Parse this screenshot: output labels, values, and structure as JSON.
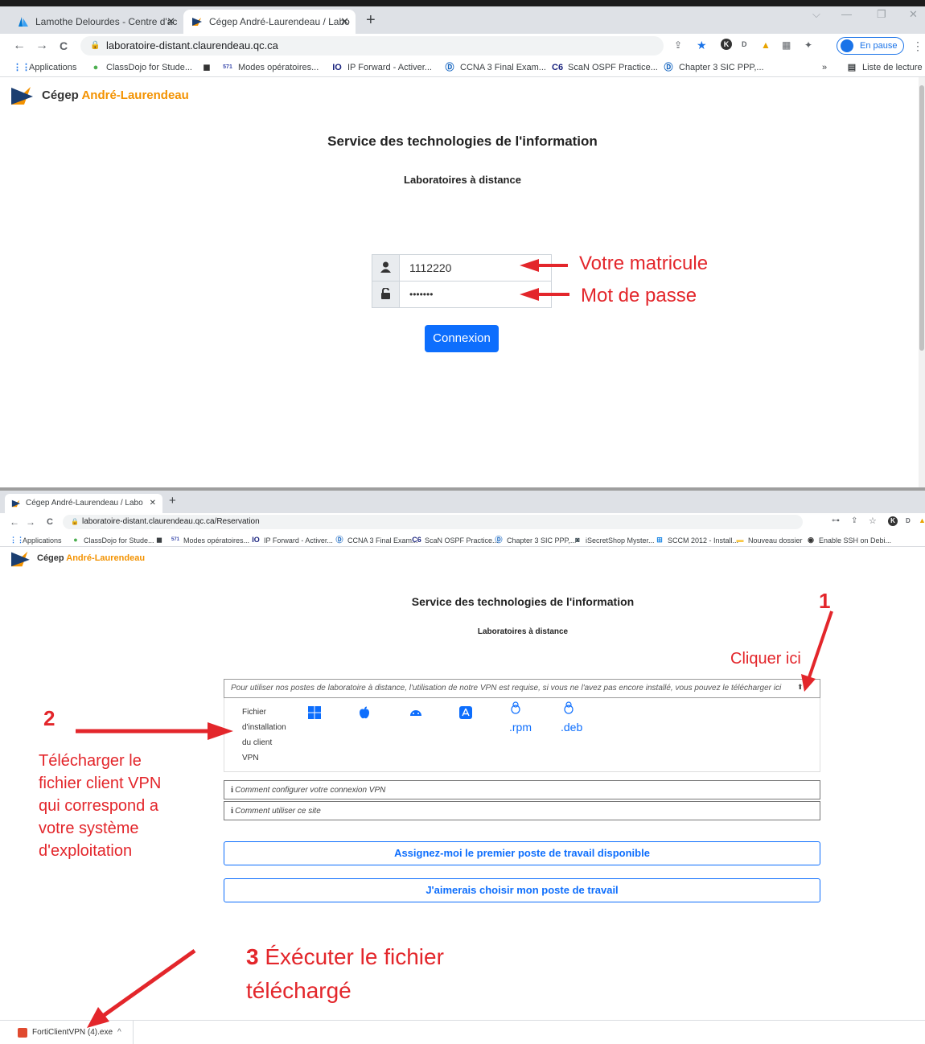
{
  "top": {
    "tabs": [
      {
        "title": "Lamothe Delourdes - Centre d'ac",
        "close": "✕"
      },
      {
        "title": "Cégep André-Laurendeau / Labo",
        "close": "✕"
      }
    ],
    "new_tab": "+",
    "window_controls": {
      "dropdown": "⌵",
      "minimize": "—",
      "restore": "❐",
      "close": "✕"
    },
    "nav": {
      "back": "←",
      "forward": "→",
      "reload": "C"
    },
    "url": "laboratoire-distant.claurendeau.qc.ca",
    "toolbar_icons": {
      "share": "⇪",
      "star": "★",
      "ext_k": "K",
      "ext_d": "D",
      "ext_3": "▲",
      "ext_4": "▦",
      "puzzle": "✦",
      "menu": "⋮"
    },
    "profile_label": "En pause",
    "bookmarks": [
      {
        "icon": "⋮⋮",
        "label": "Applications"
      },
      {
        "icon": "●",
        "label": "ClassDojo for Stude..."
      },
      {
        "icon": "◼",
        "label": ""
      },
      {
        "icon": "571",
        "label": "Modes opératoires..."
      },
      {
        "icon": "IO",
        "label": "IP Forward - Activer..."
      },
      {
        "icon": "Ⓓ",
        "label": "CCNA 3 Final Exam..."
      },
      {
        "icon": "C6",
        "label": "ScaN OSPF Practice..."
      },
      {
        "icon": "Ⓓ",
        "label": "Chapter 3 SIC PPP,..."
      }
    ],
    "bookmarks_more": "»",
    "reading_list": "Liste de lecture",
    "logo": {
      "prefix": "Cégep ",
      "accent": "André-Laurendeau"
    },
    "heading": "Service des technologies de l'information",
    "subheading": "Laboratoires à distance",
    "username_value": "1112220",
    "password_value": "•••••••",
    "login_button": "Connexion"
  },
  "bottom": {
    "tab_title": "Cégep André-Laurendeau / Labo",
    "tab_close": "✕",
    "new_tab": "+",
    "nav": {
      "back": "←",
      "forward": "→",
      "reload": "C"
    },
    "url": "laboratoire-distant.claurendeau.qc.ca/Reservation",
    "toolbar_icons": {
      "key": "⊶",
      "share": "⇪",
      "star": "☆",
      "ext_k": "K",
      "ext_d": "D",
      "ext_3": "▲"
    },
    "bookmarks": [
      {
        "icon": "⋮⋮",
        "label": "Applications"
      },
      {
        "icon": "●",
        "label": "ClassDojo for Stude..."
      },
      {
        "icon": "◼",
        "label": ""
      },
      {
        "icon": "571",
        "label": "Modes opératoires..."
      },
      {
        "icon": "IO",
        "label": "IP Forward - Activer..."
      },
      {
        "icon": "Ⓓ",
        "label": "CCNA 3 Final Exam..."
      },
      {
        "icon": "C6",
        "label": "ScaN OSPF Practice..."
      },
      {
        "icon": "Ⓓ",
        "label": "Chapter 3 SIC PPP,..."
      },
      {
        "icon": "◙",
        "label": "iSecretShop Myster..."
      },
      {
        "icon": "⊞",
        "label": "SCCM 2012 - Install..."
      },
      {
        "icon": "▬",
        "label": "Nouveau dossier"
      },
      {
        "icon": "◉",
        "label": "Enable SSH on Debi..."
      }
    ],
    "logo": {
      "prefix": "Cégep ",
      "accent": "André-Laurendeau"
    },
    "heading": "Service des technologies de l'information",
    "subheading": "Laboratoires à distance",
    "vpn_notice": "Pour utiliser nos postes de laboratoire à distance, l'utilisation de notre VPN est requise, si vous ne l'avez pas encore installé, vous pouvez le télécharger ici",
    "vpn_download_icon": "⬆",
    "installer_label_lines": [
      "Fichier",
      "d'installation",
      "du client",
      "VPN"
    ],
    "os_labels": {
      "rpm": ".rpm",
      "deb": ".deb"
    },
    "info_icon": "i",
    "info_rows": [
      "Comment configurer votre connexion VPN",
      "Comment utiliser ce site"
    ],
    "assign_button": "Assignez-moi le premier poste de travail disponible",
    "choose_button": "J'aimerais choisir mon poste de travail",
    "download_file": "FortiClientVPN (4).exe",
    "download_chevron": "^"
  },
  "annotations": {
    "matricule": "Votre matricule",
    "password": "Mot de passe",
    "step1_number": "1",
    "step1_text": "Cliquer ici",
    "step2_number": "2",
    "step2_lines": [
      "Télécharger le",
      "fichier client VPN",
      "qui correspond a",
      "votre système",
      "d'exploitation"
    ],
    "step3_number": "3",
    "step3_line1": "Éxécuter le fichier",
    "step3_line2": "téléchargé"
  },
  "colors": {
    "annotation_red": "#e3262b",
    "primary_blue": "#0d6efd",
    "logo_orange": "#f39200"
  }
}
